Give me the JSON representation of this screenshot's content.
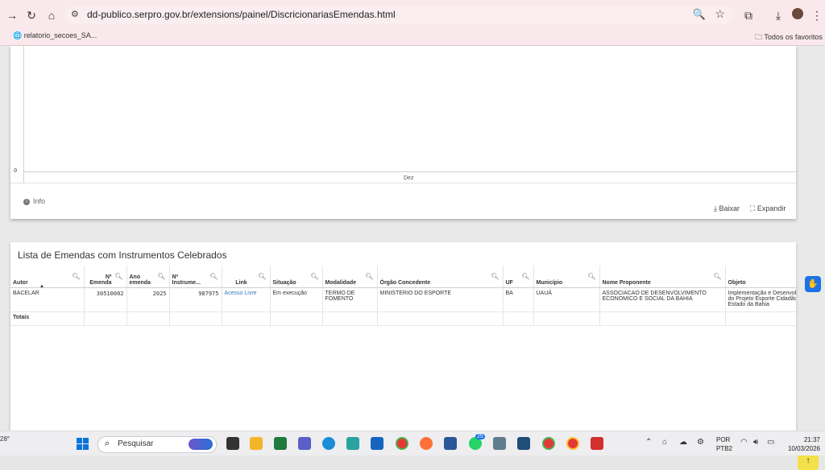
{
  "browser": {
    "url_domain": "dd-publico.serpro.gov.br",
    "url_path": "/extensions/painel/DiscricionariasEmendas.html",
    "bookmark_left": "relatorio_secoes_SA...",
    "bookmark_right": "Todos os favoritos"
  },
  "chart_data": {
    "type": "bar",
    "categories": [
      "Dez"
    ],
    "values": [
      0
    ],
    "y_ticks": [
      "0"
    ],
    "title": "",
    "xlabel": "",
    "ylabel": ""
  },
  "card1": {
    "info": "Info",
    "download": "Baixar",
    "expand": "Expandir"
  },
  "table": {
    "title": "Lista de Emendas com Instrumentos Celebrados",
    "headers": [
      "Autor",
      "Nº Emenda",
      "Ano emenda",
      "Nº Instrume...",
      "Link",
      "Situação",
      "Modalidade",
      "Órgão Concedente",
      "UF",
      "Município",
      "Nome Proponente",
      "Objeto"
    ],
    "rows": [
      [
        "BACELAR",
        "30510002",
        "2025",
        "987975",
        "Acesso Livre",
        "Em execução",
        "TERMO DE FOMENTO",
        "MINISTERIO DO ESPORTE",
        "BA",
        "UAUÁ",
        "ASSOCIACAO DE DESENVOLVIMENTO ECONOMICO E SOCIAL DA BAHIA",
        "Implementação e Desenvolv do Projeto Esporte Cidadão Estado da Bahia"
      ]
    ],
    "totals_label": "Totais"
  },
  "taskbar": {
    "search": "Pesquisar",
    "temp": "28°",
    "lang1": "POR",
    "lang2": "PTB2",
    "time": "21:37",
    "date": "10/03/2026",
    "badge_whatsapp": "25"
  }
}
